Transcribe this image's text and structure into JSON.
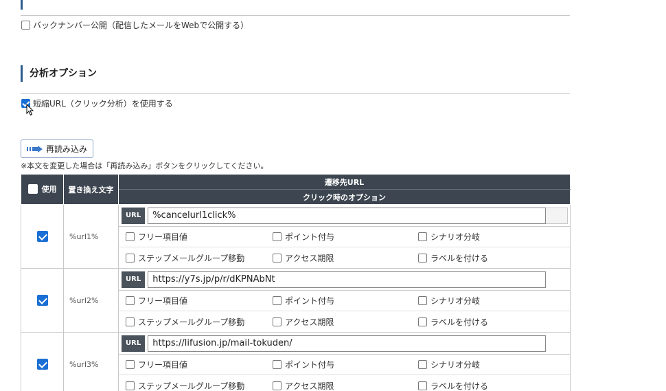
{
  "backnumber": {
    "label": "バックナンバー公開（配信したメールをWebで公開する）",
    "checked": false
  },
  "analysis": {
    "title": "分析オプション",
    "short_url_label": "短縮URL（クリック分析）を使用する",
    "short_url_checked": true
  },
  "reload": {
    "button_label": "再読み込み",
    "note": "※本文を変更した場合は「再読み込み」ボタンをクリックしてください。"
  },
  "table": {
    "header_use": "使用",
    "header_replace": "置き換え文字",
    "header_dest": "遷移先URL",
    "header_options": "クリック時のオプション",
    "url_label": "URL",
    "option_labels": [
      "フリー項目値",
      "ポイント付与",
      "シナリオ分岐",
      "ステップメールグループ移動",
      "アクセス期限",
      "ラベルを付ける"
    ],
    "rows": [
      {
        "tag": "%url1%",
        "url": "%cancelurl1click%",
        "checked": true
      },
      {
        "tag": "%url2%",
        "url": "https://y7s.jp/p/r/dKPNAbNt",
        "checked": true
      },
      {
        "tag": "%url3%",
        "url": "https://lifusion.jp/mail-tokuden/",
        "checked": true
      }
    ]
  },
  "colors": {
    "accent": "#2a5b8f",
    "header_bg": "#3d4650",
    "check": "#1a6fd4"
  }
}
